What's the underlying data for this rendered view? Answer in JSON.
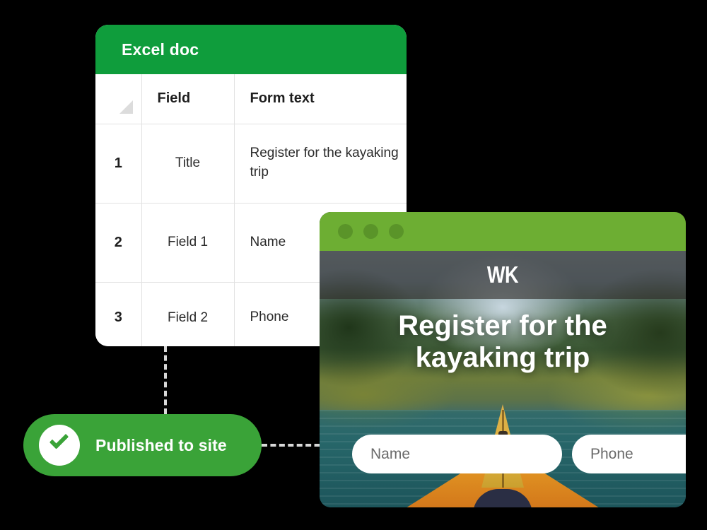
{
  "colors": {
    "background": "#000000",
    "excel_header_green": "#0F9D3C",
    "browser_chrome_green": "#6DAE33",
    "badge_green": "#3AA338",
    "dashed_line": "#D8D8D8"
  },
  "excel_card": {
    "title": "Excel doc",
    "corner_icon": "select-all-triangle-icon",
    "columns": [
      "",
      "Field",
      "Form text"
    ],
    "rows": [
      {
        "num": "1",
        "field": "Title",
        "form_text": "Register for the kayaking trip"
      },
      {
        "num": "2",
        "field": "Field 1",
        "form_text": "Name"
      },
      {
        "num": "3",
        "field": "Field 2",
        "form_text": "Phone"
      }
    ]
  },
  "badge": {
    "label": "Published to site",
    "icon": "check-circle-icon"
  },
  "browser": {
    "traffic_lights": [
      "dot-1",
      "dot-2",
      "dot-3"
    ],
    "site": {
      "logo": "WK",
      "headline": "Register for the kayaking trip",
      "form": {
        "fields": [
          {
            "name": "name-field",
            "placeholder": "Name",
            "value": ""
          },
          {
            "name": "phone-field",
            "placeholder": "Phone",
            "value": ""
          }
        ]
      },
      "hero_image": "kayak-on-mountain-river-photo"
    }
  }
}
